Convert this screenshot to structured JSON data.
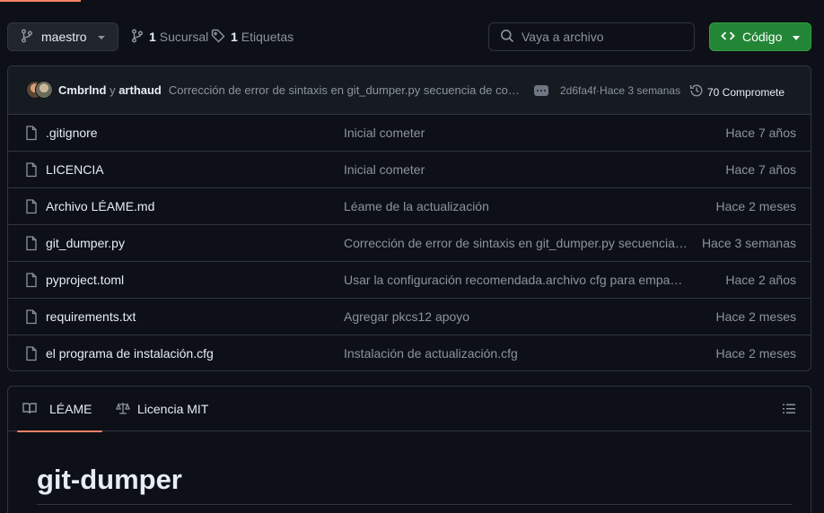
{
  "branch": {
    "name": "maestro"
  },
  "meta": {
    "branches_count": "1",
    "branches_label": "Sucursal",
    "tags_count": "1",
    "tags_label": "Etiquetas"
  },
  "search": {
    "placeholder": "Vaya a archivo"
  },
  "code_button": {
    "label": "Código"
  },
  "latest_commit": {
    "author1": "Cmbrlnd",
    "conjunction": "y",
    "author2": "arthaud",
    "message": "Corrección de error de sintaxis en git_dumper.py secuencia de comandos",
    "hash_time": "2d6fa4f·Hace 3 semanas",
    "commits_label": "70 Compromete"
  },
  "files": [
    {
      "name": ".gitignore",
      "message": "Inicial cometer",
      "time": "Hace 7 años"
    },
    {
      "name": "LICENCIA",
      "message": "Inicial cometer",
      "time": "Hace 7 años"
    },
    {
      "name": "Archivo LÉAME.md",
      "message": "Léame de la actualización",
      "time": "Hace 2 meses"
    },
    {
      "name": "git_dumper.py",
      "message": "Corrección de error de sintaxis en git_dumper.py secuencia de comandos",
      "time": "Hace 3 semanas"
    },
    {
      "name": "pyproject.toml",
      "message": "Usar la configuración recomendada.archivo cfg para empaquetado",
      "time": "Hace 2 años"
    },
    {
      "name": "requirements.txt",
      "message": "Agregar pkcs12 apoyo",
      "time": "Hace 2 meses"
    },
    {
      "name": "el programa de instalación.cfg",
      "message": "Instalación de actualización.cfg",
      "time": "Hace 2 meses"
    }
  ],
  "readme": {
    "tab_readme": "LÉAME",
    "tab_license": "Licencia MIT",
    "title": "git-dumper"
  },
  "colors": {
    "background": "#0d1117",
    "border": "#30363d",
    "primary_button": "#238636",
    "accent": "#f78166",
    "muted_text": "#8b949e"
  }
}
